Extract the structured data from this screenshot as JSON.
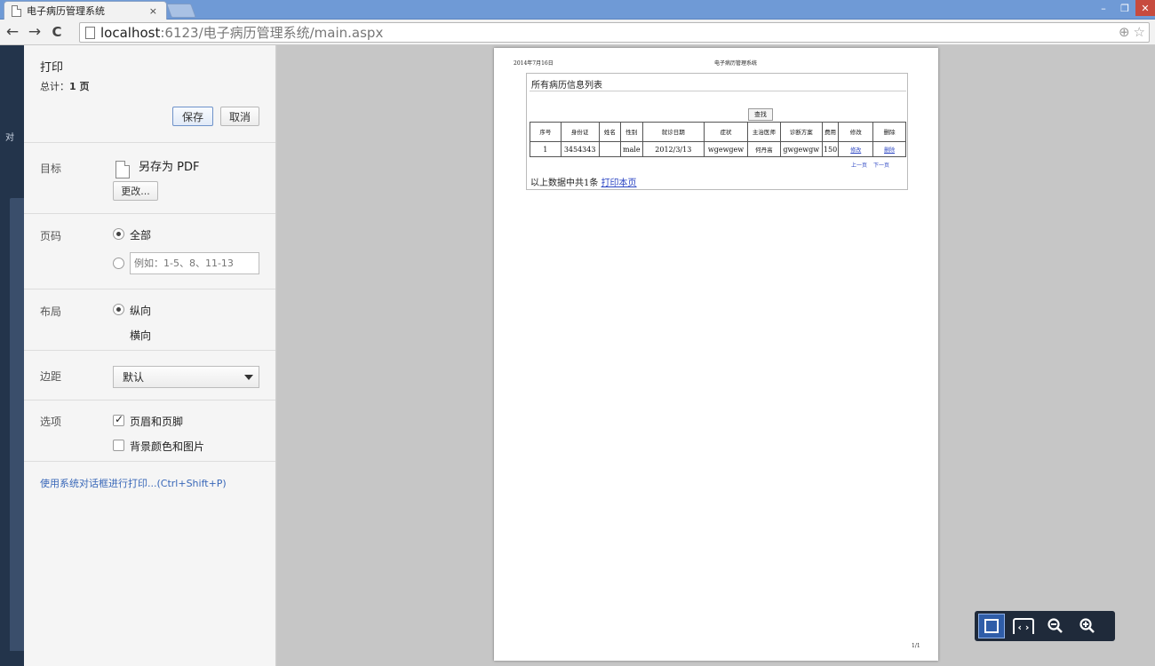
{
  "browser": {
    "tab_title": "电子病历管理系统",
    "tab_close": "×",
    "url_host": "localhost",
    "url_path": ":6123/电子病历管理系统/main.aspx",
    "nav_back": "←",
    "nav_forward": "→",
    "nav_reload": "C",
    "zoom_icon": "⊕",
    "star_icon": "☆",
    "win_minimize": "–",
    "win_restore": "❐",
    "win_close": "✕"
  },
  "left_edge": {
    "text": "对"
  },
  "print": {
    "title": "打印",
    "total_prefix": "总计：",
    "total_pages": "1 页",
    "save_label": "保存",
    "cancel_label": "取消",
    "destination": {
      "label": "目标",
      "value": "另存为 PDF",
      "change_label": "更改..."
    },
    "pages": {
      "label": "页码",
      "all_label": "全部",
      "custom_placeholder": "例如：1-5、8、11-13"
    },
    "layout": {
      "label": "布局",
      "portrait": "纵向",
      "landscape": "横向"
    },
    "margins": {
      "label": "边距",
      "value": "默认"
    },
    "options": {
      "label": "选项",
      "header_footer": "页眉和页脚",
      "background": "背景颜色和图片"
    },
    "system_dialog": "使用系统对话框进行打印...(Ctrl+Shift+P)"
  },
  "page": {
    "header_date": "2014年7月16日",
    "header_title": "电子病历管理系统",
    "page_number": "1/1",
    "caption": "所有病历信息列表",
    "find_label": "查找",
    "columns": [
      "序号",
      "身份证",
      "姓名",
      "性别",
      "就诊日期",
      "症状",
      "主治医师",
      "诊断方案",
      "费用",
      "修改",
      "删除"
    ],
    "rows": [
      [
        "1",
        "3454343",
        "",
        "male",
        "2012/3/13",
        "wgewgew",
        "何丹高",
        "gwgewgw",
        "150",
        "修改",
        "删除"
      ]
    ],
    "pager_prev": "上一页",
    "pager_next": "下一页",
    "footer_text": "以上数据中共1条",
    "footer_link": "打印本页"
  },
  "zoom": {
    "fit_icon": "fit-page-icon",
    "width_icon": "‹ ›",
    "zoom_out_icon": "zoom-out-icon",
    "zoom_in_icon": "zoom-in-icon"
  }
}
